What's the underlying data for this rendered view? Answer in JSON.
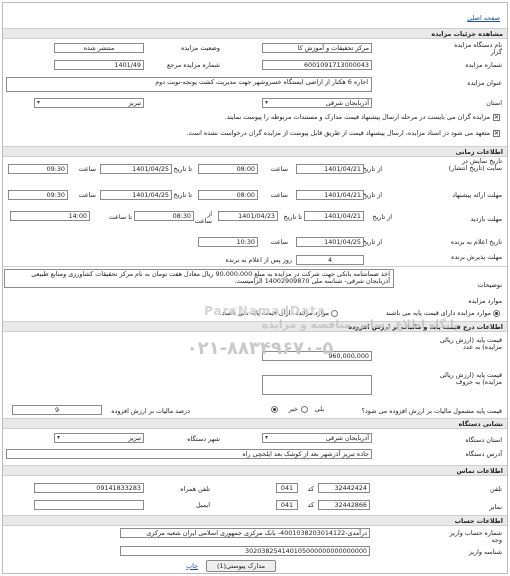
{
  "nav": {
    "home_link": "صفحه اصلی"
  },
  "sections": {
    "details": "مشاهده جزئیات مزایده",
    "timing": "اطلاعات زمانی",
    "tender": "اطلاعات مزایده",
    "price": "اطلاعات درج قیمت پایه و مالیات بر ارزش افزوده",
    "device": "نشانی دستگاه",
    "contact": "اطلاعات تماس",
    "accounts": "اطلاعات حساب"
  },
  "details": {
    "org_label": "نام دستگاه مزایده گزار",
    "org_value": "مرکز تحقیقات و آموزش کا",
    "status_label": "وضعیت مزایده",
    "status_value": "منتشر شده",
    "number_label": "شماره مزایده",
    "number_value": "6001091713000043",
    "ref_label": "شماره مزایده مرجع",
    "ref_value": "1401/49",
    "title_label": "عنوان مزایده",
    "title_value": "اجاره 6 هکتار از اراضی ایستگاه خسروشهر جهت مدیریت کشت پونجه-نوبت دوم",
    "province_label": "استان",
    "province_value": "آذربایجان شرقی",
    "city_value": "تبریز",
    "check1": "مزایده گران می بایست در مرحله ارسال پیشنهاد قیمت مدارک و مستندات مربوطه را پیوست نمایند.",
    "check2": "متعهد می شود در اسناد مزایده، ارسال پیشنهاد قیمت از طریق قابل پیوست از مزایده گران درخواست نشده است."
  },
  "timing": {
    "from_label": "از تاریخ",
    "to_label": "تا تاریخ",
    "time_label": "ساعت",
    "display_label": "تاریخ نمایش در سایت (تاریخ انتشار)",
    "display_from_date": "1401/04/21",
    "display_from_time": "08:00",
    "display_to_date": "1401/04/25",
    "display_to_time": "09:30",
    "offer_label": "مهلت ارائه پیشنهاد",
    "offer_from_date": "1401/04/21",
    "offer_from_time": "08:00",
    "offer_to_date": "1401/04/25",
    "offer_to_time": "09:30",
    "visit_label": "مهلت بازدید",
    "visit_from_date": "1401/04/21",
    "visit_from_time_label": "از ساعت",
    "visit_to_date": "1401/04/23",
    "visit_to_time_label": "تا ساعت",
    "visit_from_time": "08:30",
    "visit_to_time": "14:00",
    "announce_label": "تاریخ اعلام به برنده",
    "announce_date": "1401/04/25",
    "announce_time": "10:30",
    "accept_label": "مهلت پذیرش برنده",
    "accept_value": "4",
    "accept_suffix": "روز پس از اعلام به برنده"
  },
  "tender": {
    "desc_label": "توضیحات",
    "desc_value": "اخذ ضمانتنامه بانکی جهت شرکت در مزایده به مبلغ 90،000،000 ریال معادل هفت تومان به نام مرکز تحقیقات کشاورزی ومنابع طبیعی آذربایجان شرقی- شناسه ملی 14002909870 الزامیست.",
    "base_label": "موارد مزایده",
    "radio_with": "موارد مزایده دارای قیمت پایه می باشند",
    "radio_without": "موارد مزایده دارای قیمت پایه نمی باشند."
  },
  "price": {
    "base_rial_label": "قیمت پایه (ارزش ریالی مزایده) به عدد",
    "base_rial_value": "960,000,000",
    "base_words_label": "قیمت پایه (ارزش ریالی مزایده) به حروف",
    "vat_question": "قیمت پایه مشمول مالیات بر ارزش افزوده می شود؟",
    "yes": "بلی",
    "no": "خیر",
    "vat_percent_label": "درصد مالیات بر ارزش افزوده",
    "vat_percent_value": "9"
  },
  "device": {
    "province_label": "استان دستگاه",
    "province_value": "آذربایجان شرقی",
    "city_label": "شهر دستگاه",
    "city_value": "تبریز",
    "address_label": "آدرس دستگاه",
    "address_value": "جاده تبریز آذرشهر بعد از کوشک بعد ایلخچی راه"
  },
  "contact": {
    "phone_label": "تلفن",
    "phone_code": "041",
    "code_label": "کد",
    "phone_value": "32442424",
    "mobile_label": "تلفن همراه",
    "mobile_value": "09141833283",
    "fax_label": "نمابر",
    "fax_code": "041",
    "fax_value": "32442866",
    "email_label": "ایمیل",
    "email_value": ""
  },
  "accounts": {
    "deposit_label": "شماره حساب واریز وجه",
    "deposit_value": "درآمدی-4001038203014122- بانک مرکزی جمهوری اسلامی ایران شعبه مرکزی",
    "sheba_label": "شناسه واریز",
    "sheba_value": "302038254140105000000000000000"
  },
  "footer": {
    "attach_button": "مدارک پیوستی(1)",
    "print_link": "چاپ"
  },
  "watermark": {
    "brand": "ParsNamadData",
    "line1": "پایگاه اطلاع رسانی مناقصه و مزایده",
    "phone": "۰۲۱-۸۸۳۴۹۶۷۰-۵"
  }
}
